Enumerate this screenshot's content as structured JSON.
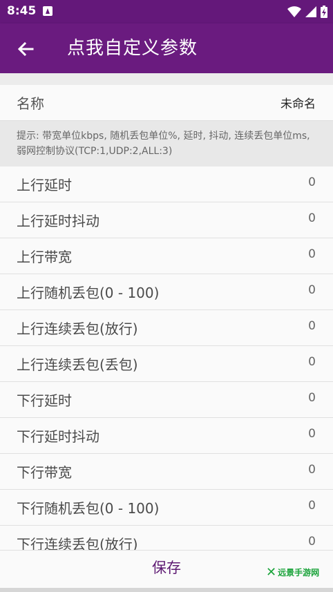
{
  "status_bar": {
    "time": "8:45",
    "notification_icon": "text-a-icon",
    "wifi_icon": "wifi-icon",
    "signal_icon": "signal-icon",
    "battery_icon": "battery-charging-icon"
  },
  "toolbar": {
    "back_icon": "arrow-left-icon",
    "title": "点我自定义参数",
    "color": "#6a1b7f"
  },
  "name_row": {
    "label": "名称",
    "value": "未命名"
  },
  "tip": "提示: 带宽单位kbps, 随机丢包单位%, 延时, 抖动, 连续丢包单位ms, 弱网控制协议(TCP:1,UDP:2,ALL:3)",
  "params": [
    {
      "label": "上行延时",
      "value": "0"
    },
    {
      "label": "上行延时抖动",
      "value": "0"
    },
    {
      "label": "上行带宽",
      "value": "0"
    },
    {
      "label": "上行随机丢包(0 - 100)",
      "value": "0"
    },
    {
      "label": "上行连续丢包(放行)",
      "value": "0"
    },
    {
      "label": "上行连续丢包(丢包)",
      "value": "0"
    },
    {
      "label": "下行延时",
      "value": "0"
    },
    {
      "label": "下行延时抖动",
      "value": "0"
    },
    {
      "label": "下行带宽",
      "value": "0"
    },
    {
      "label": "下行随机丢包(0 - 100)",
      "value": "0"
    },
    {
      "label": "下行连续丢包(放行)",
      "value": "0"
    }
  ],
  "save_label": "保存",
  "watermark": "远景手游网"
}
